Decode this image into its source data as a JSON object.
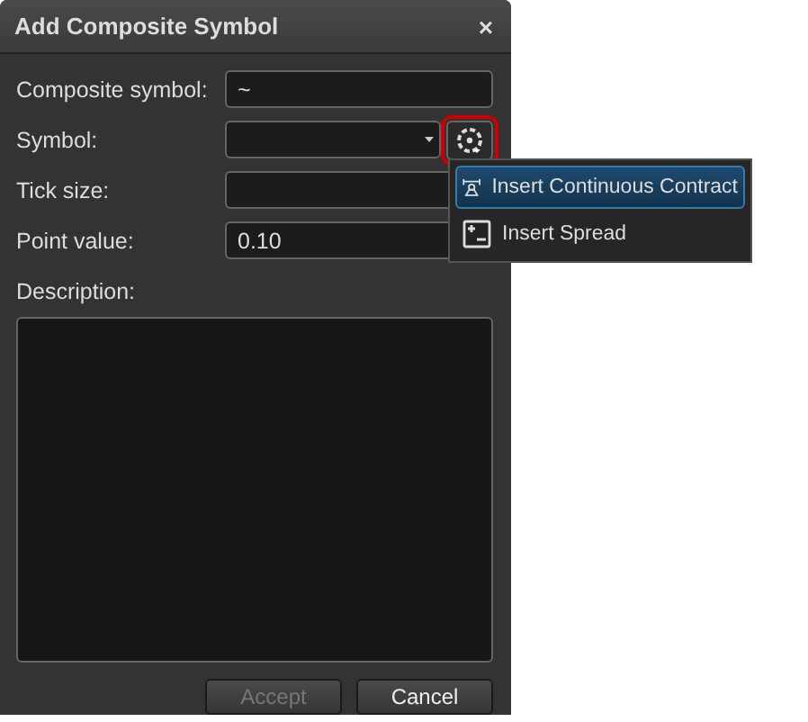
{
  "window": {
    "title": "Add Composite Symbol",
    "close": "×"
  },
  "fields": [
    {
      "label": "Composite symbol:",
      "kind": "text",
      "value": "~"
    },
    {
      "label": "Symbol:",
      "kind": "dropdown",
      "tool_highlighted": true
    },
    {
      "label": "Tick size:",
      "kind": "text"
    },
    {
      "label": "Point value:",
      "kind": "text",
      "value": "0.10"
    }
  ],
  "description": {
    "label": "Description:"
  },
  "menu": [
    {
      "label": "Insert Continuous Contract",
      "kind": "contract",
      "selected": true
    },
    {
      "label": "Insert Spread",
      "kind": "spread",
      "selected": false
    }
  ],
  "buttons": [
    {
      "label": "Accept",
      "disabled": true
    },
    {
      "label": "Cancel",
      "disabled": false
    }
  ]
}
